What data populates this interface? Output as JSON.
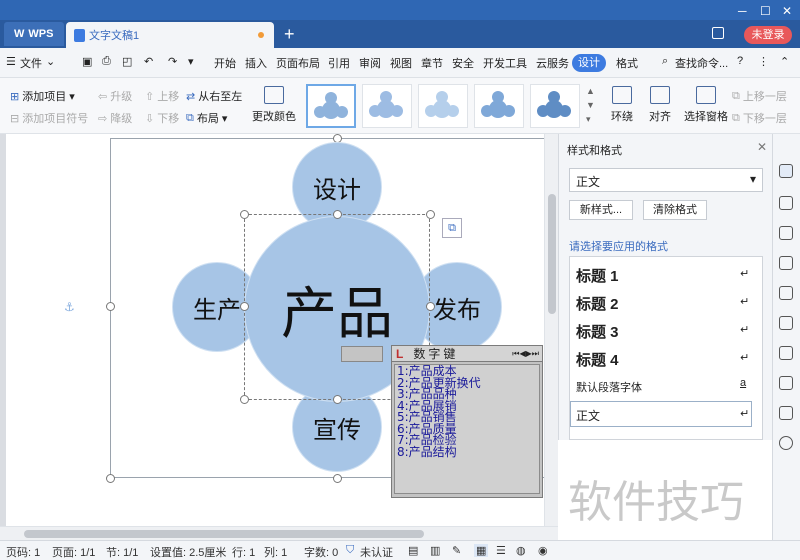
{
  "tabs": {
    "app_label": "WPS",
    "doc_label": "文字文稿1",
    "login_label": "未登录"
  },
  "menu": {
    "file_label": "文件",
    "items": [
      "开始",
      "插入",
      "页面布局",
      "引用",
      "审阅",
      "视图",
      "章节",
      "安全",
      "开发工具",
      "云服务",
      "设计",
      "格式"
    ],
    "active": "设计",
    "search_label": "查找命令..."
  },
  "ribbon": {
    "add_item": "添加项目",
    "add_bullet": "添加项目符号",
    "promote": "升级",
    "demote": "降级",
    "move_up": "上移",
    "move_down": "下移",
    "right_to_left": "从右至左",
    "layout": "布局",
    "change_color": "更改颜色",
    "wrap": "环绕",
    "align": "对齐",
    "select_pane": "选择窗格",
    "prev_level": "上移一层",
    "next_level": "下移一层"
  },
  "diagram": {
    "center": "产品",
    "top": "设计",
    "left": "生产",
    "right": "发布",
    "bottom": "宣传",
    "accent_color": "#a7c5e6"
  },
  "ime": {
    "title": "数字键",
    "items": [
      "1:产品成本",
      "2:产品更新换代",
      "3:产品品种",
      "4:产品展销",
      "5:产品销售",
      "6:产品质量",
      "7:产品检验",
      "8:产品结构"
    ]
  },
  "panel": {
    "title": "样式和格式",
    "current_style": "正文",
    "new_style": "新样式...",
    "clear_format": "清除格式",
    "apply_label": "请选择要应用的格式",
    "styles": [
      "标题 1",
      "标题 2",
      "标题 3",
      "标题 4"
    ],
    "default_font": "默认段落字体",
    "body": "正文"
  },
  "status": {
    "page_num": "页码: 1",
    "pages": "页面: 1/1",
    "section": "节: 1/1",
    "setting": "设置值: 2.5厘米",
    "row": "行: 1",
    "col": "列: 1",
    "words": "字数: 0",
    "unverified": "未认证"
  },
  "watermark": "软件技巧"
}
